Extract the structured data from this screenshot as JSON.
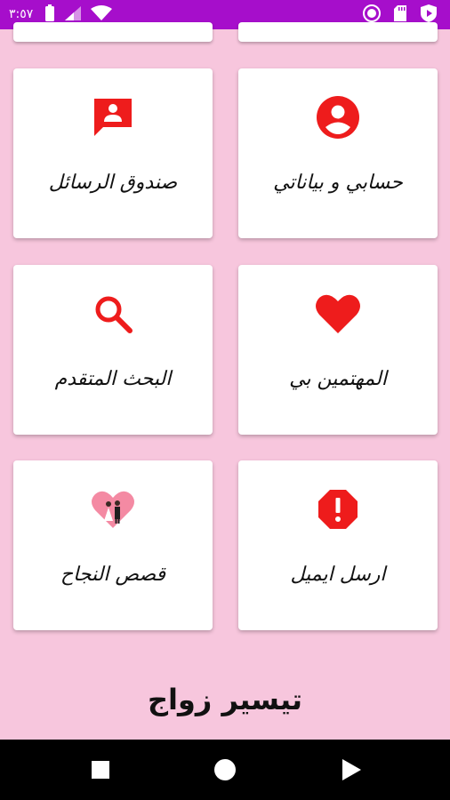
{
  "status_bar": {
    "time": "٣:٥٧",
    "background": "#a60ecb"
  },
  "app": {
    "title": "تيسير زواج",
    "background": "#f7c6dd",
    "accent": "#ee1c1c"
  },
  "cards": [
    {
      "label": "حسابي و بياناتي",
      "icon": "account-circle-icon"
    },
    {
      "label": "صندوق الرسائل",
      "icon": "message-contact-icon"
    },
    {
      "label": "المهتمين بي",
      "icon": "heart-icon"
    },
    {
      "label": "البحث المتقدم",
      "icon": "search-icon"
    },
    {
      "label": "ارسل ايميل",
      "icon": "report-octagon-icon"
    },
    {
      "label": "قصص النجاح",
      "icon": "wedding-couple-heart-icon"
    }
  ],
  "nav": {
    "buttons": [
      "recents-button",
      "home-button",
      "back-button"
    ]
  }
}
